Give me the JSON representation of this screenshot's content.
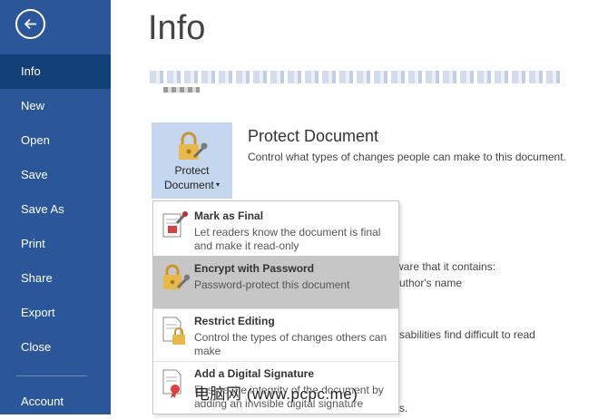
{
  "nav": {
    "items": [
      {
        "label": "Info",
        "active": true
      },
      {
        "label": "New"
      },
      {
        "label": "Open"
      },
      {
        "label": "Save"
      },
      {
        "label": "Save As"
      },
      {
        "label": "Print"
      },
      {
        "label": "Share"
      },
      {
        "label": "Export"
      },
      {
        "label": "Close"
      },
      {
        "label": "Account"
      }
    ]
  },
  "page": {
    "title": "Info"
  },
  "protect": {
    "button_line1": "Protect",
    "button_line2": "Document",
    "title": "Protect Document",
    "description": "Control what types of changes people can make to this document."
  },
  "behind": {
    "line1": "ware that it contains:",
    "line2": "uthor's name",
    "line3": "sabilities find difficult to read",
    "line4": "s."
  },
  "menu": {
    "items": [
      {
        "title": "Mark as Final",
        "desc": "Let readers know the document is final and make it read-only"
      },
      {
        "title": "Encrypt with Password",
        "desc": "Password-protect this document",
        "highlighted": true
      },
      {
        "title": "Restrict Editing",
        "desc": "Control the types of changes others can make"
      },
      {
        "title": "Add a Digital Signature",
        "desc": "Ensure the integrity of the document by adding an invisible digital signature"
      }
    ]
  },
  "watermark": "电脑网 (www.pcpc.me)",
  "colors": {
    "sidebar": "#2b579a",
    "sidebar_active": "#124078",
    "button_bg": "#c5d7ef",
    "menu_highlight": "#c6c6c6",
    "lock_gold": "#e8b84a"
  }
}
